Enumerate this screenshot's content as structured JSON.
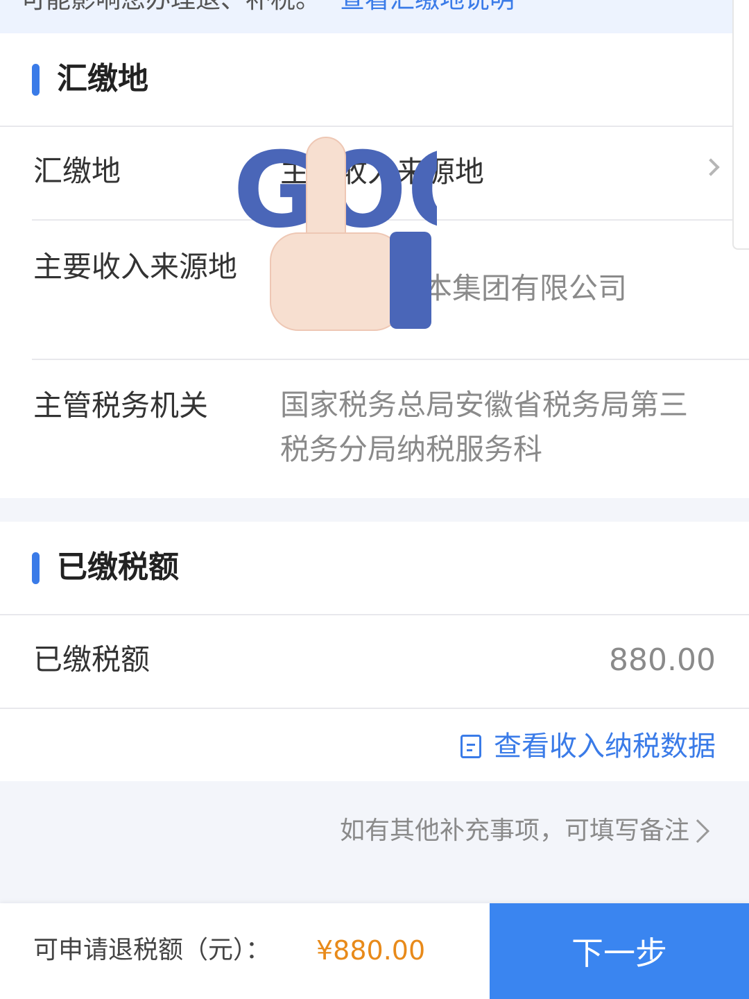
{
  "banner": {
    "text": "可能影响您办理退、补税。",
    "link": "查看汇缴地说明"
  },
  "section1": {
    "title": "汇缴地",
    "rows": [
      {
        "label": "汇缴地",
        "value": "主要收入来源地"
      },
      {
        "label": "主要收入来源地",
        "value": "本集团有限公司"
      },
      {
        "label": "主管税务机关",
        "value": "国家税务总局安徽省税务局第三税务分局纳税服务科"
      }
    ]
  },
  "section2": {
    "title": "已缴税额",
    "row": {
      "label": "已缴税额",
      "value": "880.00"
    },
    "data_link": "查看收入纳税数据"
  },
  "remark": "如有其他补充事项，可填写备注",
  "footer": {
    "label": "可申请退税额（元）：",
    "amount": "¥880.00",
    "next_button": "下一步"
  },
  "sticker_text": "GOOD",
  "colors": {
    "accent": "#3a7be8",
    "amount": "#e88a1a",
    "button": "#3a85f0"
  }
}
